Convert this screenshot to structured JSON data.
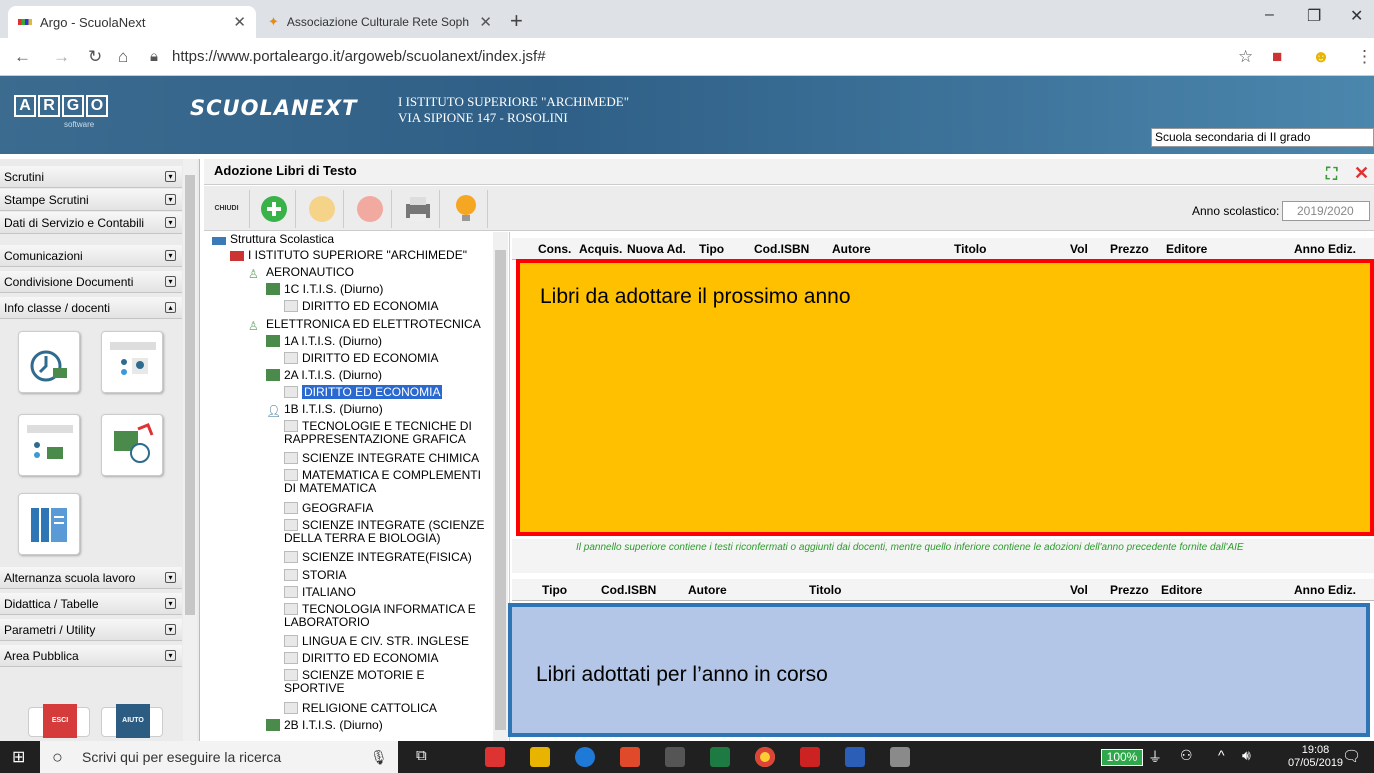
{
  "browser": {
    "tabs": [
      {
        "label": "Argo - ScuolaNext"
      },
      {
        "label": "Associazione Culturale Rete Soph"
      }
    ],
    "url": "https://www.portaleargo.it/argoweb/scuolanext/index.jsf#"
  },
  "header": {
    "logo_letters": [
      "A",
      "R",
      "G",
      "O"
    ],
    "logo_sub": "software",
    "app_name": "SCUOLANEXT",
    "school_name": "I ISTITUTO SUPERIORE \"ARCHIMEDE\"",
    "school_address": "VIA SIPIONE 147 - ROSOLINI",
    "school_type": "Scuola secondaria di II grado"
  },
  "menu": {
    "items_top": [
      "Scrutini",
      "Stampe Scrutini",
      "Dati di Servizio e Contabili",
      "Comunicazioni",
      "Condivisione Documenti",
      "Info classe / docenti"
    ],
    "items_bottom": [
      "Alternanza scuola lavoro",
      "Didattica / Tabelle",
      "Parametri / Utility",
      "Area Pubblica"
    ],
    "esci": "ESCI",
    "aiuto": "AIUTO"
  },
  "panel": {
    "title": "Adozione Libri di Testo",
    "chiudi": "CHIUDI",
    "anno_label": "Anno scolastico:",
    "anno_value": "2019/2020"
  },
  "tree": [
    "Struttura Scolastica",
    "I ISTITUTO SUPERIORE \"ARCHIMEDE\"",
    "AERONAUTICO",
    "1C I.T.I.S. (Diurno)",
    "DIRITTO ED ECONOMIA",
    "ELETTRONICA ED ELETTROTECNICA",
    "1A I.T.I.S. (Diurno)",
    "DIRITTO ED ECONOMIA",
    "2A I.T.I.S. (Diurno)",
    "DIRITTO ED ECONOMIA",
    "1B I.T.I.S. (Diurno)",
    "TECNOLOGIE E TECNICHE DI\nRAPPRESENTAZIONE GRAFICA",
    "SCIENZE INTEGRATE CHIMICA",
    "MATEMATICA E COMPLEMENTI\nDI MATEMATICA",
    "GEOGRAFIA",
    "SCIENZE INTEGRATE (SCIENZE\nDELLA TERRA E BIOLOGIA)",
    "SCIENZE INTEGRATE(FISICA)",
    "STORIA",
    "ITALIANO",
    "TECNOLOGIA INFORMATICA E\nLABORATORIO",
    "LINGUA E CIV. STR. INGLESE",
    "DIRITTO ED ECONOMIA",
    "SCIENZE MOTORIE E\nSPORTIVE",
    "RELIGIONE CATTOLICA",
    "2B I.T.I.S. (Diurno)"
  ],
  "grid_top": {
    "columns": [
      "Cons.",
      "Acquis.",
      "Nuova Ad.",
      "Tipo",
      "Cod.ISBN",
      "Autore",
      "Titolo",
      "Vol",
      "Prezzo",
      "Editore",
      "Anno Ediz."
    ],
    "overlay": "Libri da adottare il prossimo anno"
  },
  "note": "Il pannello superiore contiene i testi riconfermati o aggiunti dai docenti, mentre quello inferiore contiene le adozioni dell'anno precedente fornite dall'AIE",
  "grid_bottom": {
    "columns": [
      "Tipo",
      "Cod.ISBN",
      "Autore",
      "Titolo",
      "Vol",
      "Prezzo",
      "Editore",
      "Anno Ediz."
    ],
    "overlay": "Libri adottati per l’anno in corso"
  },
  "taskbar": {
    "search_placeholder": "Scrivi qui per eseguire la ricerca",
    "battery": "100%",
    "time": "19:08",
    "date": "07/05/2019"
  }
}
